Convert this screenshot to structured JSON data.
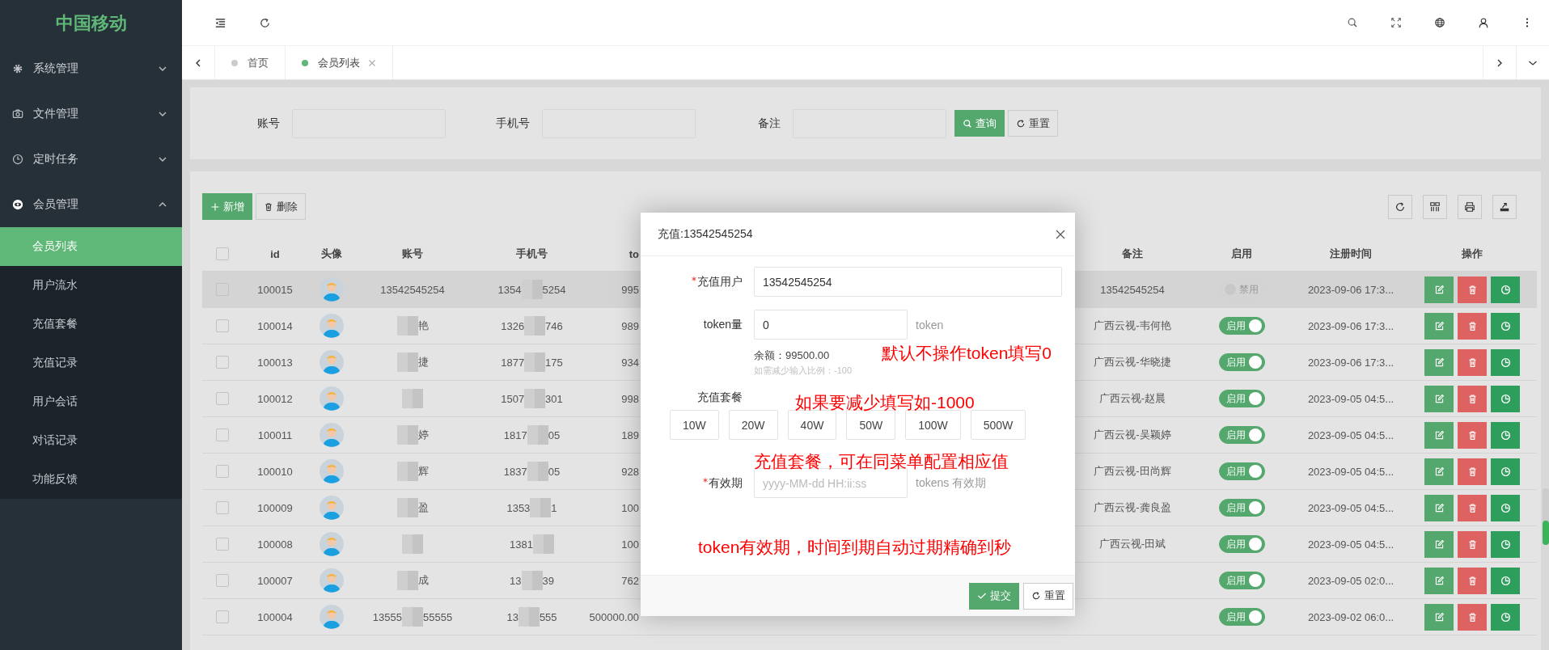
{
  "sidebar": {
    "logo": "中国移动",
    "menus": [
      {
        "label": "系统管理",
        "expanded": false
      },
      {
        "label": "文件管理",
        "expanded": false
      },
      {
        "label": "定时任务",
        "expanded": false
      },
      {
        "label": "会员管理",
        "expanded": true,
        "children": [
          {
            "label": "会员列表",
            "selected": true
          },
          {
            "label": "用户流水",
            "selected": false
          },
          {
            "label": "充值套餐",
            "selected": false
          },
          {
            "label": "充值记录",
            "selected": false
          },
          {
            "label": "用户会话",
            "selected": false
          },
          {
            "label": "对话记录",
            "selected": false
          },
          {
            "label": "功能反馈",
            "selected": false
          }
        ]
      }
    ]
  },
  "tabs": [
    {
      "label": "首页",
      "selected": false,
      "closable": false
    },
    {
      "label": "会员列表",
      "selected": true,
      "closable": true
    }
  ],
  "search": {
    "fields": [
      {
        "label": "账号"
      },
      {
        "label": "手机号"
      },
      {
        "label": "备注"
      }
    ],
    "buttons": [
      {
        "label": "查询",
        "kind": "primary"
      },
      {
        "label": "重置",
        "kind": "default"
      }
    ]
  },
  "toolbar": {
    "buttons": [
      {
        "label": "新增",
        "kind": "add"
      },
      {
        "label": "删除",
        "kind": "delete"
      }
    ]
  },
  "table": {
    "all_checked": false,
    "columns": [
      "id",
      "头像",
      "账号",
      "手机号",
      "to",
      "备注",
      "启用",
      "注册时间",
      "操作"
    ],
    "rows": [
      {
        "checked": false,
        "hovered": true,
        "id": "100015",
        "account": [
          "13542545254"
        ],
        "masked": false,
        "phone": [
          "1354",
          "5254"
        ],
        "token": "995",
        "remark": "13542545254",
        "enabled": false,
        "switch_label": "禁用",
        "time": "2023-09-06 17:3..."
      },
      {
        "checked": false,
        "hovered": false,
        "id": "100014",
        "account": [
          "艳"
        ],
        "masked": true,
        "phone": [
          "1326",
          "746"
        ],
        "token": "989",
        "remark": "广西云视-韦何艳",
        "enabled": true,
        "switch_label": "启用",
        "time": "2023-09-06 17:3..."
      },
      {
        "checked": false,
        "hovered": false,
        "id": "100013",
        "account": [
          "捷"
        ],
        "masked": true,
        "phone": [
          "1877",
          "175"
        ],
        "token": "934",
        "remark": "广西云视-华晓捷",
        "enabled": true,
        "switch_label": "启用",
        "time": "2023-09-06 17:3..."
      },
      {
        "checked": false,
        "hovered": false,
        "id": "100012",
        "masked": true,
        "phone": [
          "1507",
          "301"
        ],
        "token": "998",
        "remark": "广西云视-赵晨",
        "enabled": true,
        "switch_label": "启用",
        "time": "2023-09-05 04:5..."
      },
      {
        "checked": false,
        "hovered": false,
        "id": "100011",
        "account": [
          "婷"
        ],
        "masked": true,
        "phone": [
          "1817",
          "05"
        ],
        "token": "189",
        "remark": "广西云视-吴颖婷",
        "enabled": true,
        "switch_label": "启用",
        "time": "2023-09-05 04:5..."
      },
      {
        "checked": false,
        "hovered": false,
        "id": "100010",
        "account": [
          "辉"
        ],
        "masked": true,
        "phone": [
          "1837",
          "05"
        ],
        "token": "928",
        "remark": "广西云视-田尚辉",
        "enabled": true,
        "switch_label": "启用",
        "time": "2023-09-05 04:5..."
      },
      {
        "checked": false,
        "hovered": false,
        "id": "100009",
        "account": [
          "盈"
        ],
        "masked": true,
        "phone": [
          "1353",
          "1"
        ],
        "token": "100",
        "remark": "广西云视-龚良盈",
        "enabled": true,
        "switch_label": "启用",
        "time": "2023-09-05 04:5..."
      },
      {
        "checked": false,
        "hovered": false,
        "id": "100008",
        "masked": true,
        "phone": [
          "1381"
        ],
        "token": "100",
        "remark": "广西云视-田斌",
        "enabled": true,
        "switch_label": "启用",
        "time": "2023-09-05 04:5..."
      },
      {
        "checked": false,
        "hovered": false,
        "id": "100007",
        "account": [
          "成"
        ],
        "masked": true,
        "phone": [
          "13",
          "39"
        ],
        "token": "762",
        "enabled": true,
        "switch_label": "启用",
        "time": "2023-09-05 02:0..."
      },
      {
        "checked": false,
        "hovered": false,
        "id": "100004",
        "account": [
          "13555",
          "55555"
        ],
        "masked": true,
        "phone": [
          "13",
          "555"
        ],
        "token": "500000.00",
        "enabled": true,
        "switch_label": "启用",
        "time": "2023-09-02 06:0..."
      }
    ]
  },
  "dialog": {
    "title": "充值:13542545254",
    "fields": [
      {
        "kind": "text",
        "label": "充值用户",
        "required": true,
        "value": "13542545254"
      },
      {
        "kind": "number",
        "label": "token量",
        "required": false,
        "value": "0",
        "suffix": "token",
        "balance": "余额：99500.00",
        "hint": "如需减少输入比例：-100"
      },
      {
        "kind": "packages",
        "label": "充值套餐",
        "required": false,
        "options": [
          "10W",
          "20W",
          "40W",
          "50W",
          "100W",
          "500W"
        ]
      },
      {
        "kind": "date",
        "label": "有效期",
        "required": true,
        "placeholder": "yyyy-MM-dd HH:ii:ss",
        "suffix": "tokens 有效期"
      }
    ],
    "annotations": [
      "默认不操作token填写0",
      "如果要减少填写如-1000",
      "充值套餐，可在同菜单配置相应值",
      "token有效期，时间到期自动过期精确到秒"
    ],
    "buttons": [
      {
        "label": "提交",
        "kind": "primary"
      },
      {
        "label": "重置",
        "kind": "default"
      }
    ]
  }
}
